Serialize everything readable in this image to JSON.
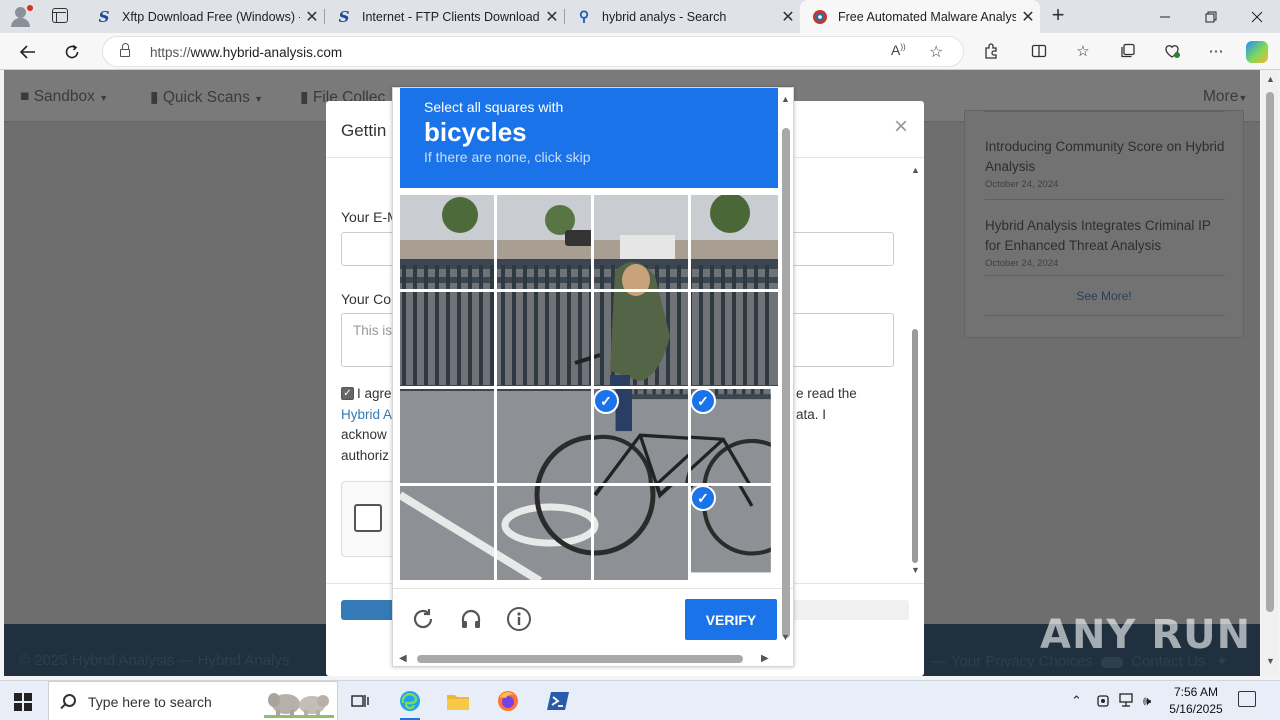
{
  "browser": {
    "tabs": [
      {
        "title": "Xftp Download Free (Windows) -",
        "favicon": "softpedia-icon"
      },
      {
        "title": "Internet - FTP Clients Downloads",
        "favicon": "softpedia-icon"
      },
      {
        "title": "hybrid analys - Search",
        "favicon": "search-icon"
      },
      {
        "title": "Free Automated Malware Analysi",
        "favicon": "hybrid-analysis-icon",
        "active": true
      }
    ],
    "url_prefix": "https://",
    "url_host": "www.hybrid-analysis.com"
  },
  "site": {
    "nav": [
      "Sandbox",
      "Quick Scans",
      "File Collec",
      "More"
    ],
    "news": [
      {
        "title": "Introducing Community Score on Hybrid Analysis",
        "date": "October 24, 2024"
      },
      {
        "title": "Hybrid Analysis Integrates Criminal IP for Enhanced Threat Analysis",
        "date": "October 24, 2024"
      }
    ],
    "see_more": "See More!",
    "footer_left": "© 2025 Hybrid Analysis — Hybrid Analys",
    "footer_right": "— Your Privacy Choices",
    "footer_contact": "Contact Us"
  },
  "modal": {
    "title": "Gettin",
    "email_label": "Your E-M",
    "comment_label": "Your Co",
    "comment_placeholder": "This is",
    "agree_start": "I agre",
    "agree_right_1": "e read the",
    "agree_link": "Hybrid A",
    "agree_right_2": "ata. I",
    "agree_line3": "acknow",
    "agree_line4": "authoriz"
  },
  "captcha": {
    "instruction": "Select all squares with",
    "target": "bicycles",
    "hint": "If there are none, click skip",
    "selected_cells": [
      10,
      11,
      15
    ],
    "verify_label": "VERIFY",
    "colors": {
      "accent": "#1a73e8"
    }
  },
  "watermark": "ANY RUN",
  "taskbar": {
    "search_placeholder": "Type here to search",
    "time": "7:56 AM",
    "date": "5/16/2025"
  }
}
